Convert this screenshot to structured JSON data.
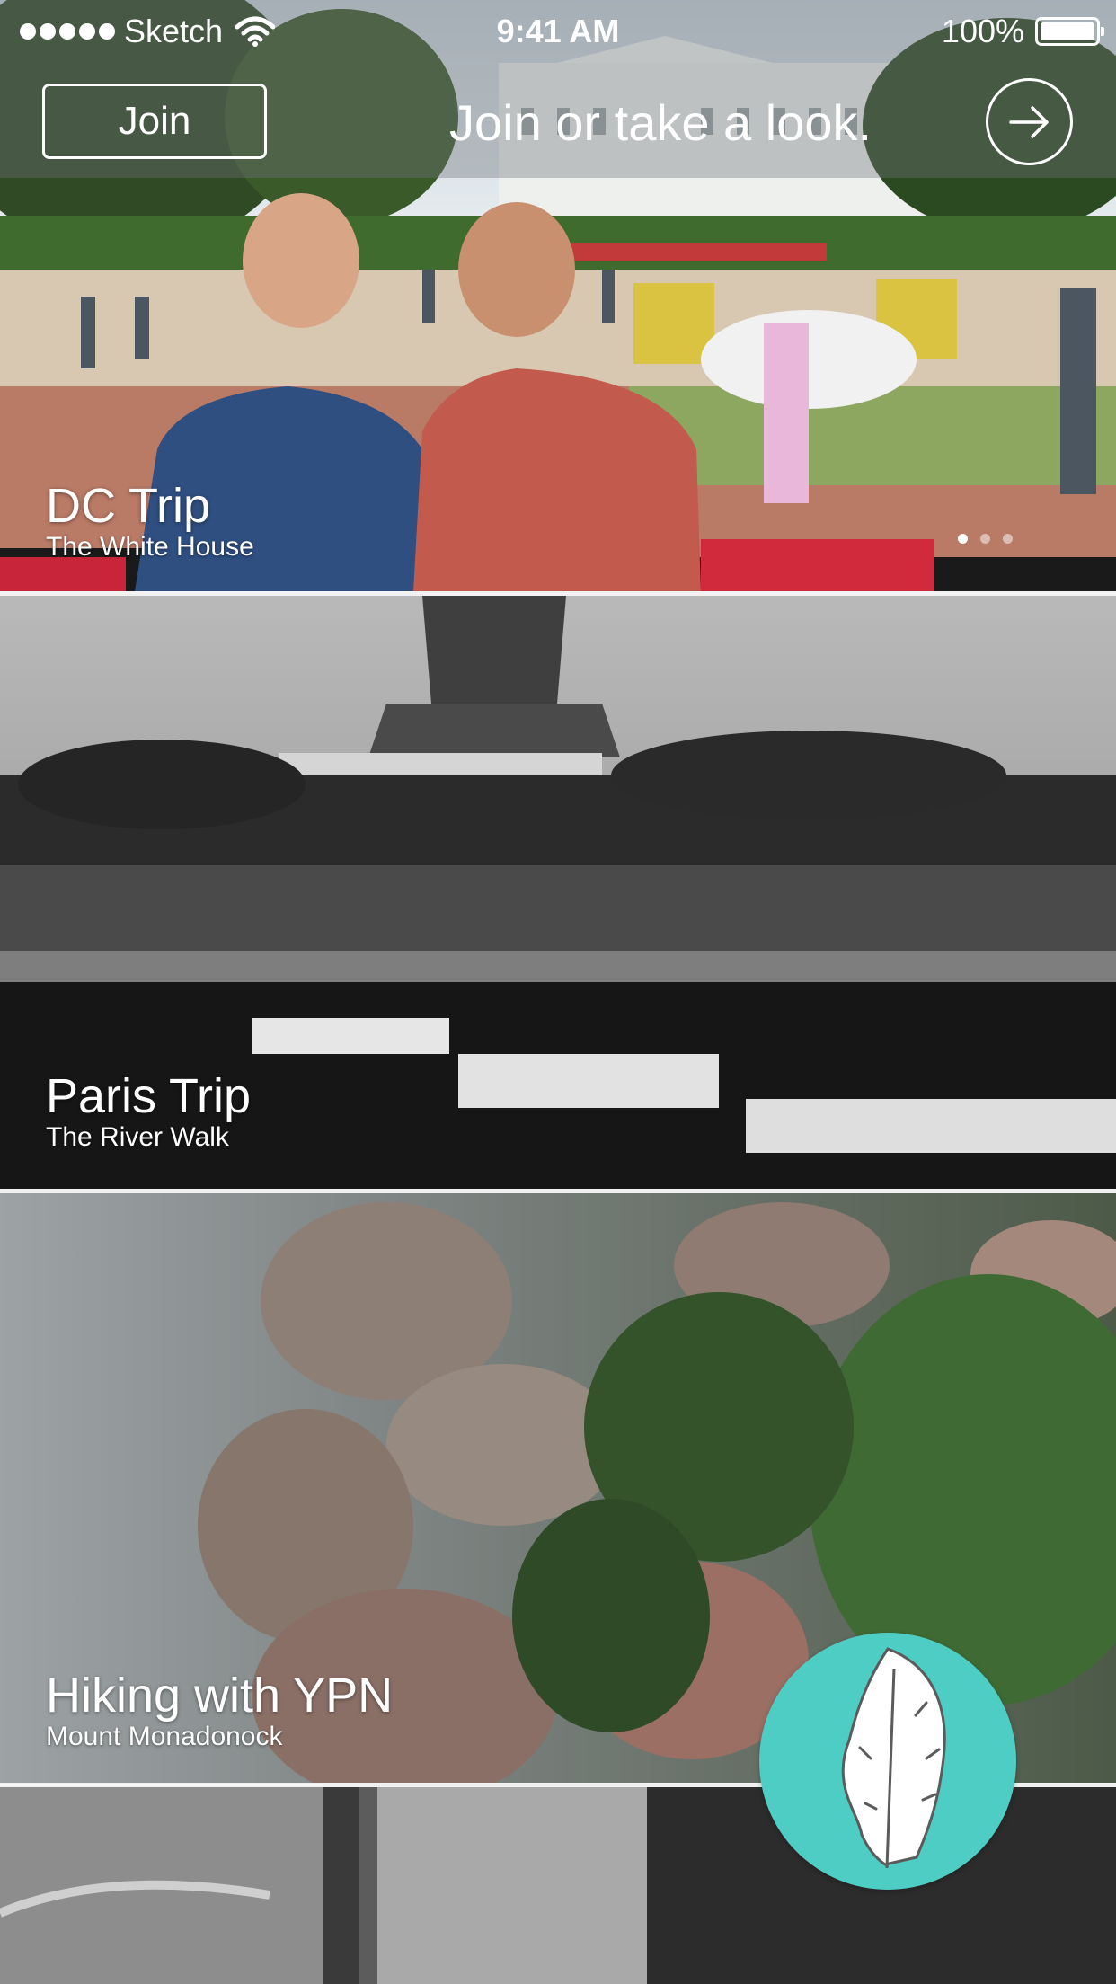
{
  "status_bar": {
    "carrier": "Sketch",
    "time": "9:41 AM",
    "battery": "100%"
  },
  "header": {
    "join_label": "Join",
    "prompt": "Join or take a look.",
    "icons": {
      "go": "arrow-right-circle-icon",
      "wifi": "wifi-icon",
      "battery": "battery-icon"
    }
  },
  "cards": [
    {
      "title": "DC Trip",
      "subtitle": "The White House"
    },
    {
      "title": "Paris Trip",
      "subtitle": "The River Walk"
    },
    {
      "title": "Hiking with YPN",
      "subtitle": "Mount Monadonock"
    }
  ],
  "pager": {
    "pages": 3,
    "active": 1
  },
  "fab": {
    "icon": "feather-icon",
    "color": "#4ecdc4"
  }
}
